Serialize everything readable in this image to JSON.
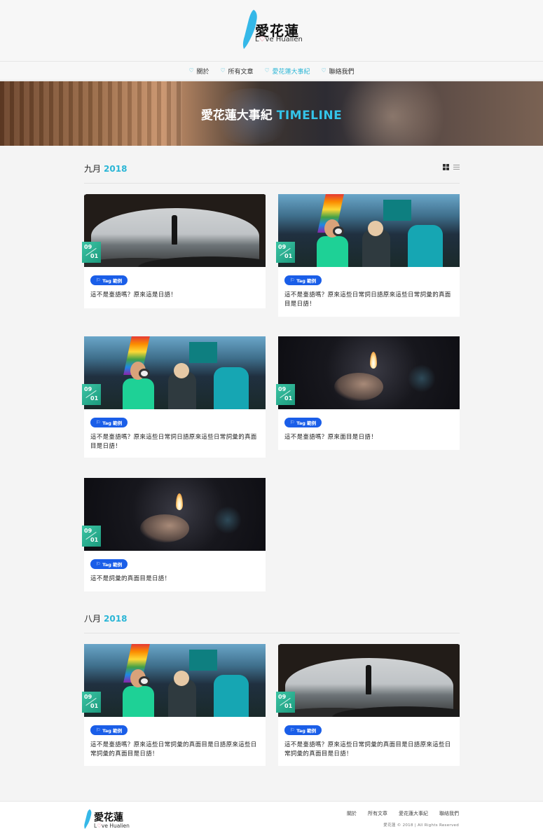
{
  "brand": {
    "title": "愛花蓮",
    "subtitle_prefix": "L",
    "subtitle_heart": "♡",
    "subtitle_suffix": "ve Hualien",
    "accent_color": "#2bb6d6",
    "island_color": "#35b8e8"
  },
  "nav": {
    "items": [
      {
        "label": "關於",
        "active": false
      },
      {
        "label": "所有文章",
        "active": false
      },
      {
        "label": "愛花蓮大事紀",
        "active": true
      },
      {
        "label": "聯絡我們",
        "active": false
      }
    ],
    "icon": "heart-outline-icon"
  },
  "banner": {
    "title_main": "愛花蓮大事紀",
    "title_accent": "TIMELINE"
  },
  "sections": [
    {
      "month": "九月",
      "year": "2018",
      "cards": [
        {
          "day_top": "09",
          "day_bottom": "01",
          "tag": "Tag 範例",
          "title": "這不是臺語嗎？原來這是日語！",
          "image": "cave"
        },
        {
          "day_top": "09",
          "day_bottom": "01",
          "tag": "Tag 範例",
          "title": "這不是臺語嗎？原來這些日常詞日語原來這些日常詞彙的真面目是日語！",
          "image": "crowd"
        },
        {
          "day_top": "09",
          "day_bottom": "01",
          "tag": "Tag 範例",
          "title": "這不是臺語嗎？原來這些日常詞日語原來這些日常詞彙的真面目是日語！",
          "image": "crowd"
        },
        {
          "day_top": "09",
          "day_bottom": "01",
          "tag": "Tag 範例",
          "title": "這不是臺語嗎？原來面目是日語！",
          "image": "lighter"
        },
        {
          "day_top": "09",
          "day_bottom": "01",
          "tag": "Tag 範例",
          "title": "這不是詞彙的真面目是日語！",
          "image": "lighter"
        }
      ]
    },
    {
      "month": "八月",
      "year": "2018",
      "cards": [
        {
          "day_top": "09",
          "day_bottom": "01",
          "tag": "Tag 範例",
          "title": "這不是臺語嗎？原來這些日常詞彙的真面目是日語原來這些日常詞彙的真面目是日語！",
          "image": "crowd"
        },
        {
          "day_top": "09",
          "day_bottom": "01",
          "tag": "Tag 範例",
          "title": "這不是臺語嗎？原來這些日常詞彙的真面目是日語原來這些日常詞彙的真面目是日語！",
          "image": "cave"
        }
      ]
    }
  ],
  "view_toggle": {
    "grid_icon": "grid-view-icon",
    "list_icon": "list-view-icon"
  },
  "footer": {
    "nav": [
      "關於",
      "所有文章",
      "愛花蓮大事紀",
      "聯絡我們"
    ],
    "copyright": "愛花蓮 © 2018 | All Rights Reserved"
  }
}
